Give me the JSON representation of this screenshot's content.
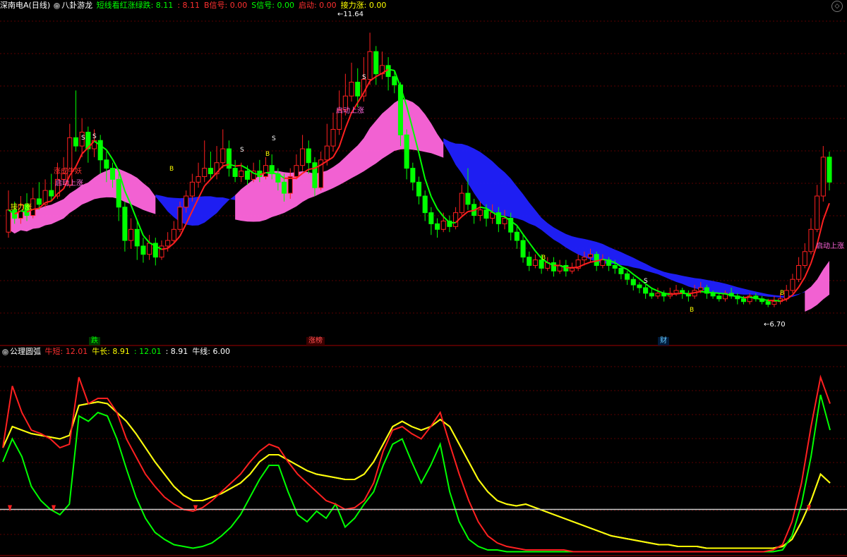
{
  "main_panel": {
    "header": {
      "stock_title": "深南电A(日线)",
      "indicator_name": "八卦游龙",
      "items": [
        {
          "label": "短线看红涨绿跌: 8.11",
          "color": "#00ff00"
        },
        {
          "label": ": 8.11",
          "color": "#ff3030"
        },
        {
          "label": "B信号: 0.00",
          "color": "#ff3030"
        },
        {
          "label": "S信号: 0.00",
          "color": "#00ff00"
        },
        {
          "label": "启动: 0.00",
          "color": "#ff3030"
        },
        {
          "label": "接力涨: 0.00",
          "color": "#ffff00"
        }
      ]
    },
    "high_marker": "11.64",
    "low_marker": "6.70",
    "annotations": [
      "涨成牛妖",
      "启动上涨",
      "接力涨",
      "启动上涨",
      "启动上涨"
    ],
    "signals": [
      "S",
      "B",
      "S",
      "S",
      "B",
      "S",
      "S",
      "B",
      "B",
      "S",
      "B"
    ],
    "bottom_tags": [
      {
        "label": "跌",
        "color": "#00ff00"
      },
      {
        "label": "涨榜",
        "color": "#ff5050"
      },
      {
        "label": "财",
        "color": "#66ccff"
      }
    ]
  },
  "sub_panel": {
    "header": {
      "indicator_name": "公理圆弧",
      "items": [
        {
          "label": "牛短: 12.01",
          "color": "#ff3030"
        },
        {
          "label": "牛长: 8.91",
          "color": "#ffff00"
        },
        {
          "label": ": 12.01",
          "color": "#00ff00"
        },
        {
          "label": ": 8.91",
          "color": "#ffffff"
        },
        {
          "label": "牛线: 6.00",
          "color": "#ffffff"
        }
      ]
    }
  },
  "chart_data": [
    {
      "type": "candlestick",
      "title": "深南电A(日线)",
      "ylim": [
        6.2,
        12.0
      ],
      "high": 11.64,
      "low": 6.7,
      "candles": [
        [
          8.05,
          8.45,
          8.8,
          7.95
        ],
        [
          8.45,
          8.3,
          8.6,
          8.2
        ],
        [
          8.3,
          8.55,
          8.7,
          8.2
        ],
        [
          8.55,
          8.35,
          8.75,
          8.25
        ],
        [
          8.35,
          8.65,
          8.85,
          8.3
        ],
        [
          8.65,
          8.55,
          8.95,
          8.45
        ],
        [
          8.55,
          8.8,
          9.0,
          8.5
        ],
        [
          8.8,
          8.7,
          9.1,
          8.6
        ],
        [
          8.7,
          9.0,
          9.3,
          8.65
        ],
        [
          9.0,
          9.1,
          9.4,
          8.9
        ],
        [
          8.9,
          9.75,
          10.0,
          8.85
        ],
        [
          9.75,
          9.6,
          10.6,
          9.5
        ],
        [
          9.6,
          9.85,
          10.1,
          9.4
        ],
        [
          9.85,
          9.55,
          9.95,
          9.3
        ],
        [
          9.55,
          9.7,
          9.9,
          9.4
        ],
        [
          9.7,
          9.35,
          9.8,
          9.1
        ],
        [
          9.35,
          9.2,
          9.5,
          8.95
        ],
        [
          9.2,
          9.0,
          9.3,
          8.85
        ],
        [
          9.0,
          8.5,
          9.1,
          8.25
        ],
        [
          8.5,
          7.9,
          8.6,
          7.7
        ],
        [
          7.9,
          8.1,
          8.3,
          7.75
        ],
        [
          8.1,
          7.8,
          8.25,
          7.55
        ],
        [
          7.8,
          7.65,
          7.95,
          7.5
        ],
        [
          7.65,
          7.85,
          8.0,
          7.55
        ],
        [
          7.85,
          7.6,
          7.95,
          7.45
        ],
        [
          7.6,
          7.8,
          7.9,
          7.55
        ],
        [
          7.8,
          7.9,
          8.05,
          7.7
        ],
        [
          7.9,
          8.1,
          8.25,
          7.85
        ],
        [
          8.1,
          8.5,
          8.6,
          8.05
        ],
        [
          8.5,
          8.7,
          8.8,
          8.4
        ],
        [
          8.7,
          8.95,
          9.1,
          8.6
        ],
        [
          8.95,
          9.05,
          9.3,
          8.85
        ],
        [
          9.05,
          9.2,
          9.7,
          8.95
        ],
        [
          9.2,
          9.1,
          9.5,
          9.0
        ],
        [
          9.1,
          9.3,
          9.6,
          9.0
        ],
        [
          9.3,
          9.55,
          9.9,
          9.2
        ],
        [
          9.55,
          9.2,
          9.7,
          9.05
        ],
        [
          9.2,
          9.05,
          9.35,
          8.95
        ],
        [
          9.05,
          9.15,
          9.3,
          8.95
        ],
        [
          9.15,
          9.0,
          9.25,
          8.9
        ],
        [
          9.0,
          9.15,
          9.3,
          8.95
        ],
        [
          9.15,
          9.05,
          9.35,
          8.95
        ],
        [
          9.05,
          9.25,
          9.4,
          9.0
        ],
        [
          9.25,
          9.1,
          9.45,
          9.0
        ],
        [
          9.1,
          8.95,
          9.2,
          8.8
        ],
        [
          8.95,
          8.75,
          9.1,
          8.6
        ],
        [
          8.75,
          9.05,
          9.2,
          8.65
        ],
        [
          9.05,
          9.25,
          9.45,
          9.0
        ],
        [
          9.25,
          9.55,
          9.8,
          9.15
        ],
        [
          9.55,
          9.3,
          9.7,
          9.1
        ],
        [
          9.3,
          8.85,
          9.4,
          8.7
        ],
        [
          8.85,
          9.35,
          9.5,
          8.8
        ],
        [
          9.35,
          9.6,
          10.0,
          9.25
        ],
        [
          9.6,
          9.9,
          10.2,
          9.5
        ],
        [
          9.9,
          10.25,
          10.6,
          9.8
        ],
        [
          10.25,
          10.5,
          10.9,
          10.15
        ],
        [
          10.5,
          10.75,
          11.1,
          10.4
        ],
        [
          10.75,
          10.5,
          11.0,
          10.3
        ],
        [
          10.5,
          10.8,
          11.2,
          10.4
        ],
        [
          10.8,
          11.3,
          11.64,
          10.7
        ],
        [
          11.3,
          10.9,
          11.4,
          10.7
        ],
        [
          10.9,
          11.05,
          11.3,
          10.8
        ],
        [
          11.05,
          10.85,
          11.2,
          10.6
        ],
        [
          10.85,
          10.7,
          10.95,
          10.55
        ],
        [
          10.7,
          9.8,
          10.75,
          9.6
        ],
        [
          9.8,
          9.2,
          9.9,
          9.0
        ],
        [
          9.2,
          8.95,
          9.3,
          8.8
        ],
        [
          8.95,
          8.7,
          9.05,
          8.55
        ],
        [
          8.7,
          8.4,
          8.8,
          8.25
        ],
        [
          8.4,
          8.2,
          8.5,
          8.0
        ],
        [
          8.2,
          8.1,
          8.3,
          7.95
        ],
        [
          8.1,
          8.25,
          8.4,
          8.05
        ],
        [
          8.25,
          8.15,
          8.35,
          8.05
        ],
        [
          8.15,
          8.4,
          8.5,
          8.1
        ],
        [
          8.4,
          8.75,
          8.9,
          8.35
        ],
        [
          8.75,
          8.55,
          9.2,
          8.45
        ],
        [
          8.55,
          8.35,
          8.65,
          8.2
        ],
        [
          8.35,
          8.45,
          8.6,
          8.25
        ],
        [
          8.45,
          8.3,
          8.55,
          8.15
        ],
        [
          8.3,
          8.4,
          8.55,
          8.2
        ],
        [
          8.4,
          8.2,
          8.5,
          8.05
        ],
        [
          8.2,
          8.3,
          8.45,
          8.1
        ],
        [
          8.3,
          8.05,
          8.4,
          7.9
        ],
        [
          8.05,
          7.9,
          8.15,
          7.75
        ],
        [
          7.9,
          7.6,
          8.0,
          7.5
        ],
        [
          7.6,
          7.45,
          7.7,
          7.35
        ],
        [
          7.45,
          7.55,
          7.65,
          7.4
        ],
        [
          7.55,
          7.4,
          7.65,
          7.3
        ],
        [
          7.4,
          7.5,
          7.6,
          7.35
        ],
        [
          7.5,
          7.35,
          7.6,
          7.25
        ],
        [
          7.35,
          7.45,
          7.55,
          7.3
        ],
        [
          7.45,
          7.35,
          7.55,
          7.25
        ],
        [
          7.35,
          7.4,
          7.5,
          7.3
        ],
        [
          7.4,
          7.55,
          7.65,
          7.35
        ],
        [
          7.55,
          7.6,
          7.7,
          7.45
        ],
        [
          7.6,
          7.65,
          7.75,
          7.5
        ],
        [
          7.65,
          7.45,
          7.7,
          7.35
        ],
        [
          7.45,
          7.55,
          7.65,
          7.4
        ],
        [
          7.55,
          7.45,
          7.6,
          7.35
        ],
        [
          7.45,
          7.4,
          7.55,
          7.3
        ],
        [
          7.4,
          7.3,
          7.45,
          7.2
        ],
        [
          7.3,
          7.2,
          7.35,
          7.1
        ],
        [
          7.2,
          7.1,
          7.25,
          7.0
        ],
        [
          7.1,
          7.05,
          7.15,
          6.95
        ],
        [
          7.05,
          6.95,
          7.1,
          6.85
        ],
        [
          6.95,
          6.9,
          7.05,
          6.85
        ],
        [
          6.9,
          6.95,
          7.05,
          6.85
        ],
        [
          6.95,
          6.9,
          7.0,
          6.8
        ],
        [
          6.9,
          6.95,
          7.05,
          6.85
        ],
        [
          6.95,
          7.0,
          7.1,
          6.9
        ],
        [
          7.0,
          6.95,
          7.05,
          6.85
        ],
        [
          6.95,
          6.9,
          7.0,
          6.8
        ],
        [
          6.9,
          7.0,
          7.1,
          6.85
        ],
        [
          7.0,
          7.05,
          7.15,
          6.95
        ],
        [
          7.05,
          6.95,
          7.1,
          6.85
        ],
        [
          6.95,
          6.9,
          7.0,
          6.85
        ],
        [
          6.9,
          6.85,
          6.95,
          6.8
        ],
        [
          6.85,
          6.95,
          7.0,
          6.8
        ],
        [
          6.95,
          6.9,
          7.05,
          6.85
        ],
        [
          6.9,
          6.85,
          6.95,
          6.75
        ],
        [
          6.85,
          6.8,
          6.9,
          6.75
        ],
        [
          6.8,
          6.9,
          6.95,
          6.75
        ],
        [
          6.9,
          6.85,
          6.95,
          6.8
        ],
        [
          6.85,
          6.8,
          6.9,
          6.75
        ],
        [
          6.8,
          6.75,
          6.85,
          6.7
        ],
        [
          6.75,
          6.8,
          6.9,
          6.7
        ],
        [
          6.8,
          6.85,
          6.95,
          6.75
        ],
        [
          6.85,
          7.0,
          7.1,
          6.8
        ],
        [
          7.0,
          7.2,
          7.3,
          6.95
        ],
        [
          7.2,
          7.45,
          7.6,
          7.15
        ],
        [
          7.45,
          7.7,
          7.85,
          7.4
        ],
        [
          7.7,
          8.1,
          8.3,
          7.65
        ],
        [
          8.1,
          8.7,
          8.9,
          8.05
        ],
        [
          8.7,
          9.4,
          9.6,
          8.6
        ],
        [
          9.4,
          8.95,
          9.5,
          8.8
        ]
      ],
      "series": [
        {
          "name": "",
          "color": "#ff2020"
        },
        {
          "name": "",
          "color": "#ff66dd"
        },
        {
          "name": "",
          "color": "#2020ff"
        }
      ]
    },
    {
      "type": "line",
      "title": "公理圆弧",
      "ylim": [
        0,
        110
      ],
      "series": [
        {
          "name": "牛短",
          "color": "#ff2020",
          "values": [
            60,
            95,
            80,
            70,
            68,
            65,
            60,
            62,
            100,
            85,
            88,
            88,
            80,
            65,
            55,
            45,
            38,
            32,
            28,
            25,
            24,
            26,
            30,
            35,
            40,
            45,
            52,
            58,
            62,
            60,
            52,
            45,
            40,
            35,
            30,
            28,
            25,
            26,
            30,
            40,
            58,
            70,
            72,
            68,
            65,
            72,
            80,
            62,
            45,
            30,
            18,
            10,
            6,
            4,
            3,
            2,
            2,
            2,
            2,
            2,
            1,
            1,
            1,
            1,
            1,
            1,
            1,
            1,
            1,
            1,
            1,
            1,
            1,
            1,
            1,
            1,
            1,
            1,
            1,
            1,
            1,
            2,
            5,
            18,
            40,
            72,
            100,
            85
          ]
        },
        {
          "name": "牛长",
          "color": "#ffff00",
          "values": [
            60,
            72,
            70,
            68,
            67,
            66,
            65,
            67,
            84,
            85,
            86,
            85,
            80,
            75,
            68,
            60,
            52,
            45,
            38,
            33,
            30,
            30,
            32,
            34,
            37,
            40,
            45,
            52,
            56,
            56,
            53,
            50,
            47,
            45,
            44,
            43,
            42,
            42,
            45,
            52,
            62,
            72,
            75,
            72,
            70,
            72,
            76,
            72,
            62,
            52,
            42,
            35,
            30,
            28,
            27,
            28,
            26,
            24,
            22,
            20,
            18,
            16,
            14,
            12,
            10,
            9,
            8,
            7,
            6,
            5,
            5,
            4,
            4,
            4,
            3,
            3,
            3,
            3,
            3,
            3,
            3,
            3,
            4,
            8,
            18,
            30,
            45,
            40
          ]
        },
        {
          "name": "",
          "color": "#00ff00",
          "values": [
            52,
            65,
            55,
            38,
            30,
            25,
            22,
            28,
            78,
            75,
            80,
            78,
            65,
            48,
            32,
            20,
            12,
            8,
            5,
            4,
            3,
            4,
            6,
            10,
            15,
            22,
            32,
            42,
            50,
            50,
            35,
            22,
            18,
            24,
            20,
            28,
            15,
            20,
            28,
            35,
            50,
            62,
            65,
            52,
            40,
            50,
            62,
            35,
            18,
            8,
            4,
            2,
            2,
            1,
            1,
            1,
            1,
            1,
            1,
            1,
            1,
            1,
            1,
            1,
            1,
            1,
            1,
            1,
            1,
            1,
            1,
            1,
            1,
            1,
            1,
            1,
            1,
            1,
            1,
            1,
            1,
            1,
            2,
            10,
            28,
            55,
            90,
            70
          ]
        },
        {
          "name": "",
          "color": "#dddddd",
          "values": [
            60,
            72,
            70,
            68,
            67,
            66,
            65,
            67,
            84,
            85,
            86,
            85,
            80,
            75,
            68,
            60,
            52,
            45,
            38,
            33,
            30,
            30,
            32,
            34,
            37,
            40,
            45,
            52,
            56,
            56,
            53,
            50,
            47,
            45,
            44,
            43,
            42,
            42,
            45,
            52,
            62,
            72,
            75,
            72,
            70,
            72,
            76,
            72,
            62,
            52,
            42,
            35,
            30,
            28,
            27,
            28,
            26,
            24,
            22,
            20,
            18,
            16,
            14,
            12,
            10,
            9,
            8,
            7,
            6,
            5,
            5,
            4,
            4,
            4,
            3,
            3,
            3,
            3,
            3,
            3,
            3,
            3,
            4,
            8,
            18,
            30,
            45,
            40
          ]
        },
        {
          "name": "牛线",
          "color": "#cccccc",
          "values": [
            25
          ]
        }
      ]
    }
  ]
}
